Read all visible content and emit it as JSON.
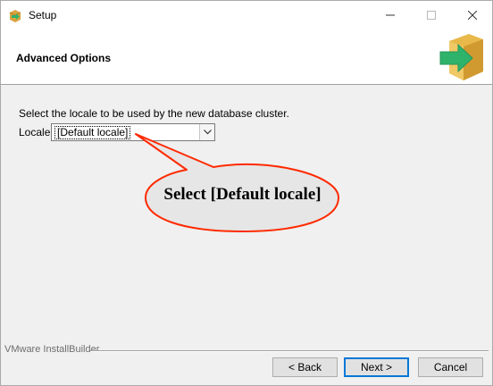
{
  "window": {
    "title": "Setup",
    "controls": {
      "minimize": "—",
      "maximize": "☐",
      "close": "✕"
    }
  },
  "header": {
    "title": "Advanced Options",
    "logo_icon": "installer-box-arrow-icon"
  },
  "main": {
    "prompt": "Select the locale to be used by the new database cluster.",
    "locale_label": "Locale",
    "locale_value": "[Default locale]"
  },
  "callout": {
    "text": "Select [Default locale]",
    "fill": "#e6e6e6",
    "stroke": "#ff2a00"
  },
  "footer": {
    "brand": "VMware InstallBuilder",
    "back_label": "< Back",
    "next_label": "Next >",
    "cancel_label": "Cancel"
  },
  "colors": {
    "logo_green": "#2fb36b",
    "logo_box": "#e8b84a",
    "focus_blue": "#0078d7"
  }
}
